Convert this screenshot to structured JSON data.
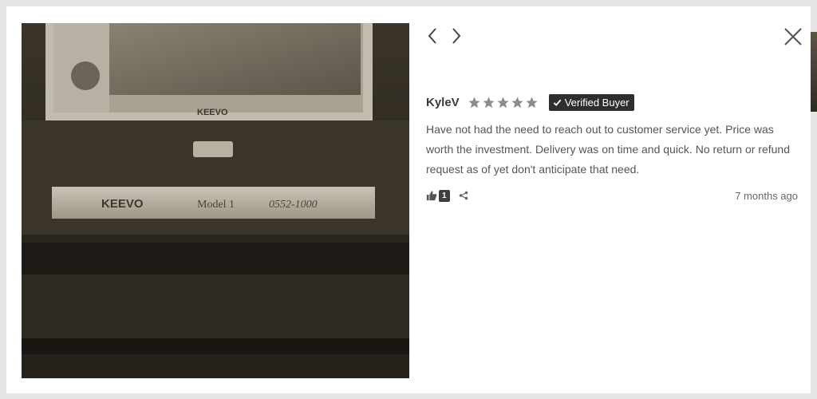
{
  "photo": {
    "brand_top": "KEEVO",
    "brand_plate": "KEEVO",
    "model_label": "Model 1",
    "serial_label": "0552-1000"
  },
  "nav": {
    "prev_icon": "chevron-left-icon",
    "next_icon": "chevron-right-icon",
    "close_icon": "close-icon"
  },
  "review": {
    "reviewer": "KyleV",
    "rating": 5,
    "rating_max": 5,
    "badge": "Verified Buyer",
    "body": "Have not had the need to reach out to customer service yet. Price was worth the investment. Delivery was on time and quick. No return or refund request as of yet don't anticipate that need.",
    "votes": "1",
    "time_ago": "7 months ago"
  },
  "colors": {
    "star": "#8c8c8c",
    "badge_bg": "#2e2e2e",
    "text": "#555555"
  }
}
